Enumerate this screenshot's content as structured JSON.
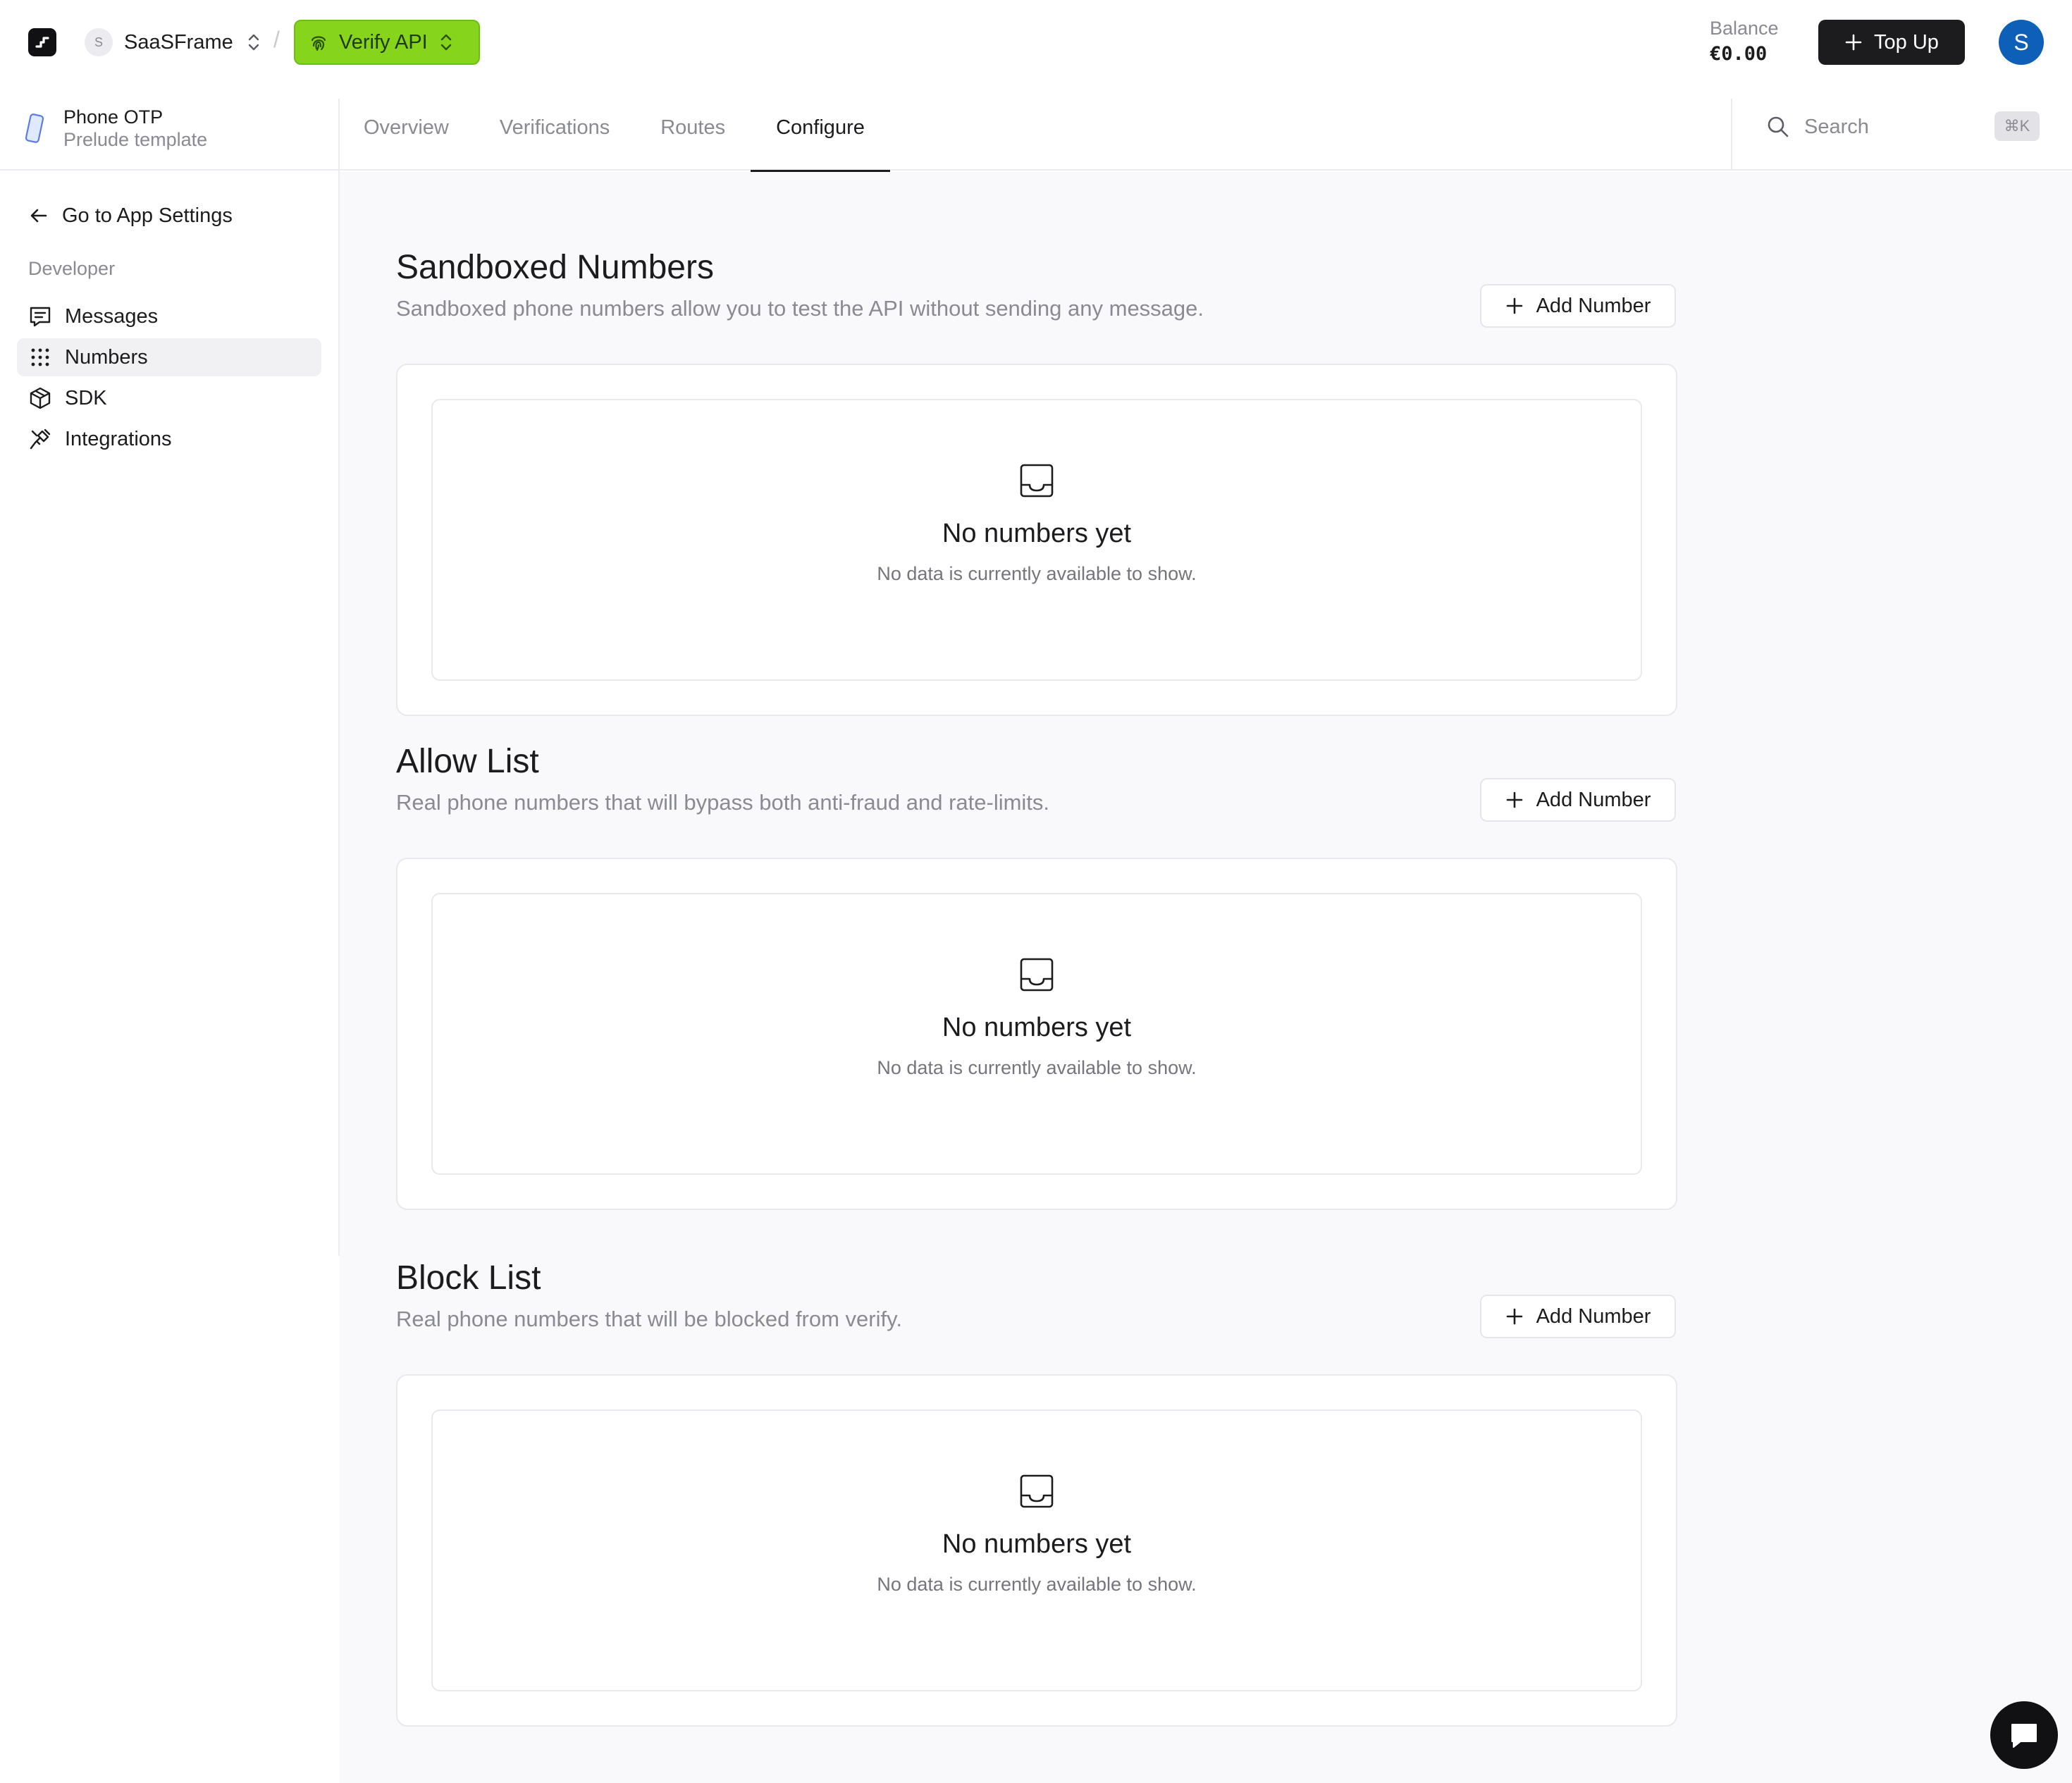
{
  "topbar": {
    "org_avatar": "S",
    "org_name": "SaaSFrame",
    "product_name": "Verify API",
    "balance_label": "Balance",
    "balance_value": "€0.00",
    "topup_label": "Top Up",
    "user_initial": "S",
    "accent_color": "#86d51c"
  },
  "subheader": {
    "app_title": "Phone OTP",
    "app_subtitle": "Prelude template",
    "tabs": [
      "Overview",
      "Verifications",
      "Routes",
      "Configure"
    ],
    "active_tab": "Configure",
    "search_placeholder": "Search",
    "search_shortcut": "⌘K"
  },
  "sidebar": {
    "back_label": "Go to App Settings",
    "section_label": "Developer",
    "items": [
      {
        "label": "Messages",
        "icon": "message-square-icon"
      },
      {
        "label": "Numbers",
        "icon": "dial-grid-icon",
        "active": true
      },
      {
        "label": "SDK",
        "icon": "package-icon"
      },
      {
        "label": "Integrations",
        "icon": "plug-icon"
      }
    ]
  },
  "sections": [
    {
      "title": "Sandboxed Numbers",
      "description": "Sandboxed phone numbers allow you to test the API without sending any message.",
      "button_label": "Add Number",
      "empty_title": "No numbers yet",
      "empty_text": "No data is currently available to show."
    },
    {
      "title": "Allow List",
      "description": "Real phone numbers that will bypass both anti-fraud and rate-limits.",
      "button_label": "Add Number",
      "empty_title": "No numbers yet",
      "empty_text": "No data is currently available to show."
    },
    {
      "title": "Block List",
      "description": "Real phone numbers that will be blocked from verify.",
      "button_label": "Add Number",
      "empty_title": "No numbers yet",
      "empty_text": "No data is currently available to show."
    }
  ]
}
